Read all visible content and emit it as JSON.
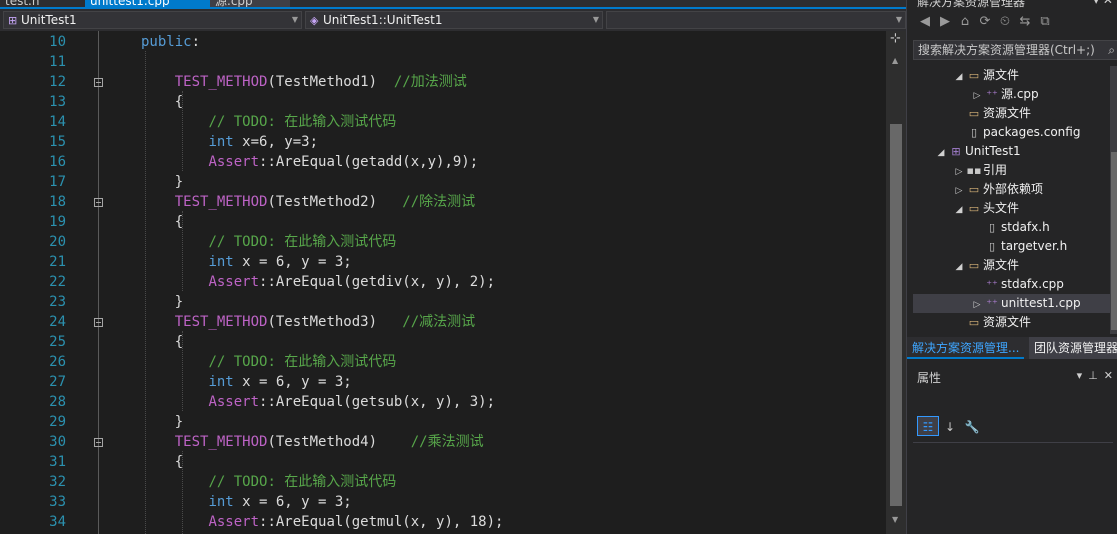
{
  "tabs": [
    {
      "label": "test.h",
      "active": false
    },
    {
      "label": "unittest1.cpp",
      "active": true
    },
    {
      "label": "源.cpp",
      "active": false
    }
  ],
  "nav": {
    "project": "UnitTest1",
    "scope": "UnitTest1::UnitTest1",
    "member": ""
  },
  "editor": {
    "lines": [
      {
        "n": "10",
        "html": "<span class=\"kw\">public</span>:"
      },
      {
        "n": "11",
        "html": ""
      },
      {
        "n": "12",
        "html": "    <span class=\"mac\">TEST_METHOD</span>(TestMethod1)  <span class=\"cmt\">//加法测试</span>"
      },
      {
        "n": "13",
        "html": "    {"
      },
      {
        "n": "14",
        "html": "        <span class=\"cmt\">// TODO: 在此输入测试代码</span>"
      },
      {
        "n": "15",
        "html": "        <span class=\"kw\">int</span> x=6, y=3;"
      },
      {
        "n": "16",
        "html": "        <span class=\"mac\">Assert</span>::AreEqual(getadd(x,y),9);"
      },
      {
        "n": "17",
        "html": "    }"
      },
      {
        "n": "18",
        "html": "    <span class=\"mac\">TEST_METHOD</span>(TestMethod2)   <span class=\"cmt\">//除法测试</span>"
      },
      {
        "n": "19",
        "html": "    {"
      },
      {
        "n": "20",
        "html": "        <span class=\"cmt\">// TODO: 在此输入测试代码</span>"
      },
      {
        "n": "21",
        "html": "        <span class=\"kw\">int</span> x = 6, y = 3;"
      },
      {
        "n": "22",
        "html": "        <span class=\"mac\">Assert</span>::AreEqual(getdiv(x, y), 2);"
      },
      {
        "n": "23",
        "html": "    }"
      },
      {
        "n": "24",
        "html": "    <span class=\"mac\">TEST_METHOD</span>(TestMethod3)   <span class=\"cmt\">//减法测试</span>"
      },
      {
        "n": "25",
        "html": "    {"
      },
      {
        "n": "26",
        "html": "        <span class=\"cmt\">// TODO: 在此输入测试代码</span>"
      },
      {
        "n": "27",
        "html": "        <span class=\"kw\">int</span> x = 6, y = 3;"
      },
      {
        "n": "28",
        "html": "        <span class=\"mac\">Assert</span>::AreEqual(getsub(x, y), 3);"
      },
      {
        "n": "29",
        "html": "    }"
      },
      {
        "n": "30",
        "html": "    <span class=\"mac\">TEST_METHOD</span>(TestMethod4)    <span class=\"cmt\">//乘法测试</span>"
      },
      {
        "n": "31",
        "html": "    {"
      },
      {
        "n": "32",
        "html": "        <span class=\"cmt\">// TODO: 在此输入测试代码</span>"
      },
      {
        "n": "33",
        "html": "        <span class=\"kw\">int</span> x = 6, y = 3;"
      },
      {
        "n": "34",
        "html": "        <span class=\"mac\">Assert</span>::AreEqual(getmul(x, y), 18);"
      }
    ],
    "colors": {
      "keyword": "#569cd6",
      "macro": "#bd63c5",
      "comment": "#57a64a",
      "lineNumber": "#2b91af"
    }
  },
  "solution_explorer": {
    "title": "解决方案资源管理器",
    "search_placeholder": "搜索解决方案资源管理器(Ctrl+;)",
    "tree": [
      {
        "level": 1,
        "expander": "◢",
        "icon": "folder",
        "label": "源文件"
      },
      {
        "level": 2,
        "expander": "▷",
        "icon": "cpp",
        "label": "源.cpp"
      },
      {
        "level": 1,
        "expander": "",
        "icon": "folder",
        "label": "资源文件"
      },
      {
        "level": 1,
        "expander": "",
        "icon": "file",
        "label": "packages.config"
      },
      {
        "level": 0,
        "expander": "◢",
        "icon": "proj",
        "label": "UnitTest1"
      },
      {
        "level": 1,
        "expander": "▷",
        "icon": "ref",
        "label": "引用"
      },
      {
        "level": 1,
        "expander": "▷",
        "icon": "folder",
        "label": "外部依赖项"
      },
      {
        "level": 1,
        "expander": "◢",
        "icon": "folder",
        "label": "头文件"
      },
      {
        "level": 2,
        "expander": "",
        "icon": "file",
        "label": "stdafx.h"
      },
      {
        "level": 2,
        "expander": "",
        "icon": "file",
        "label": "targetver.h"
      },
      {
        "level": 1,
        "expander": "◢",
        "icon": "folder",
        "label": "源文件"
      },
      {
        "level": 2,
        "expander": "",
        "icon": "cpp",
        "label": "stdafx.cpp"
      },
      {
        "level": 2,
        "expander": "▷",
        "icon": "cpp",
        "label": "unittest1.cpp",
        "selected": true
      },
      {
        "level": 1,
        "expander": "",
        "icon": "folder",
        "label": "资源文件"
      }
    ]
  },
  "panel_tabs": [
    {
      "label": "解决方案资源管理...",
      "active": true
    },
    {
      "label": "团队资源管理器",
      "active": false
    }
  ],
  "properties": {
    "title": "属性"
  }
}
